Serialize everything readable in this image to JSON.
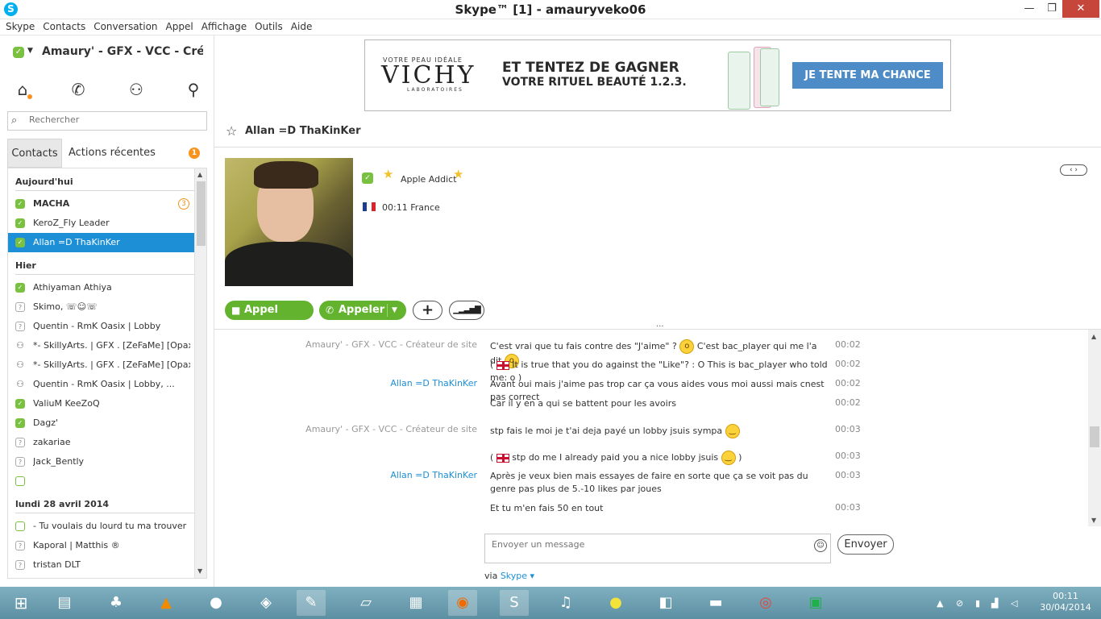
{
  "window": {
    "title": "Skype™ [1] - amauryveko06",
    "app_icon": "S",
    "min": "—",
    "max": "❐",
    "close": "✕"
  },
  "menu": [
    "Skype",
    "Contacts",
    "Conversation",
    "Appel",
    "Affichage",
    "Outils",
    "Aide"
  ],
  "profile": {
    "name": "Amaury' - GFX - VCC - Créat...",
    "status_icon": "check-icon"
  },
  "search": {
    "placeholder": "Rechercher"
  },
  "tabs": {
    "contacts": "Contacts",
    "recent": "Actions récentes",
    "recent_badge": "1"
  },
  "contact_groups": {
    "today": "Aujourd'hui",
    "yesterday": "Hier",
    "older": "lundi 28 avril 2014"
  },
  "contacts_today": [
    {
      "name": "MACHA",
      "status": "online",
      "count": "3"
    },
    {
      "name": "KeroZ_Fly Leader",
      "status": "online"
    },
    {
      "name": "Allan =D ThaKinKer",
      "status": "online"
    }
  ],
  "contacts_yesterday": [
    {
      "name": "Athiyaman Athiya",
      "status": "online"
    },
    {
      "name": "Skimo, ☏☺☏",
      "status": "unknown"
    },
    {
      "name": "Quentin - RmK Oasix | Lobby",
      "status": "unknown"
    },
    {
      "name": "*- SkillyArts. | GFX . [ZeFaMe] [Opax]...",
      "status": "group"
    },
    {
      "name": "*- SkillyArts. | GFX . [ZeFaMe] [Opax]...",
      "status": "group"
    },
    {
      "name": "Quentin - RmK Oasix | Lobby, ...",
      "status": "group"
    },
    {
      "name": "ValiuM KeeZoQ",
      "status": "online"
    },
    {
      "name": "Dagz'",
      "status": "online"
    },
    {
      "name": "zakariae",
      "status": "unknown"
    },
    {
      "name": "Jack_Bently",
      "status": "unknown"
    },
    {
      "name": "",
      "status": "empty"
    }
  ],
  "contacts_older": [
    {
      "name": "- Tu voulais du lourd tu ma trouver !!...",
      "status": "empty"
    },
    {
      "name": "Kaporal | Matthis ®",
      "status": "unknown"
    },
    {
      "name": "tristan DLT",
      "status": "unknown"
    }
  ],
  "ad": {
    "brand_top": "VOTRE PEAU IDÉALE",
    "brand": "VICHY",
    "brand_sub": "LABORATOIRES",
    "headline1": "ET TENTEZ DE GAGNER",
    "headline2": "VOTRE RITUEL BEAUTÉ 1.2.3.",
    "cta": "JE TENTE MA CHANCE"
  },
  "conversation": {
    "name": "Allan =D ThaKinKer",
    "mood": "Apple Addict",
    "local_time": "00:11 France"
  },
  "actions": {
    "video": "Appel vidéo",
    "call": "Appeler"
  },
  "messages": [
    {
      "sender": "Amaury' - GFX - VCC - Créateur de site",
      "side": "me",
      "parts": [
        "C'est vrai que tu fais contre des \"J'aime\" ? ",
        ":o",
        " C'est bac_player qui me l'a dit ",
        ":o"
      ],
      "time": "00:02"
    },
    {
      "sender": "",
      "side": "me",
      "parts": [
        "( ",
        "uk",
        " It is true that you do against the \"Like\"? : O This is bac_player who told me: o )"
      ],
      "time": "00:02"
    },
    {
      "sender": "Allan =D ThaKinKer",
      "side": "them",
      "parts": [
        "Avant oui mais j'aime pas trop car ça vous aides vous moi aussi mais cnest pas correct"
      ],
      "time": "00:02"
    },
    {
      "sender": "",
      "side": "them",
      "parts": [
        "Car il y en a qui se battent pour les avoirs"
      ],
      "time": "00:02"
    },
    {
      "sender": "Amaury' - GFX - VCC - Créateur de site",
      "side": "me",
      "parts": [
        "stp fais le moi je t'ai deja payé un lobby jsuis sympa ",
        ":)"
      ],
      "time": "00:03"
    },
    {
      "sender": "",
      "side": "me",
      "parts": [
        "( ",
        "uk",
        " stp do me I already paid you a nice lobby jsuis ",
        ":)",
        " )"
      ],
      "time": "00:03"
    },
    {
      "sender": "Allan =D ThaKinKer",
      "side": "them",
      "parts": [
        "Après je veux bien mais essayes de faire en sorte que ça se voit pas du genre pas plus de 5.-10 likes par joues"
      ],
      "time": "00:03"
    },
    {
      "sender": "",
      "side": "them",
      "parts": [
        "Et tu m'en fais 50 en tout"
      ],
      "time": "00:03"
    }
  ],
  "compose": {
    "placeholder": "Envoyer un message",
    "send": "Envoyer",
    "via_label": "via",
    "via_link": "Skype ▾"
  },
  "taskbar": {
    "clock_time": "00:11",
    "clock_date": "30/04/2014"
  }
}
